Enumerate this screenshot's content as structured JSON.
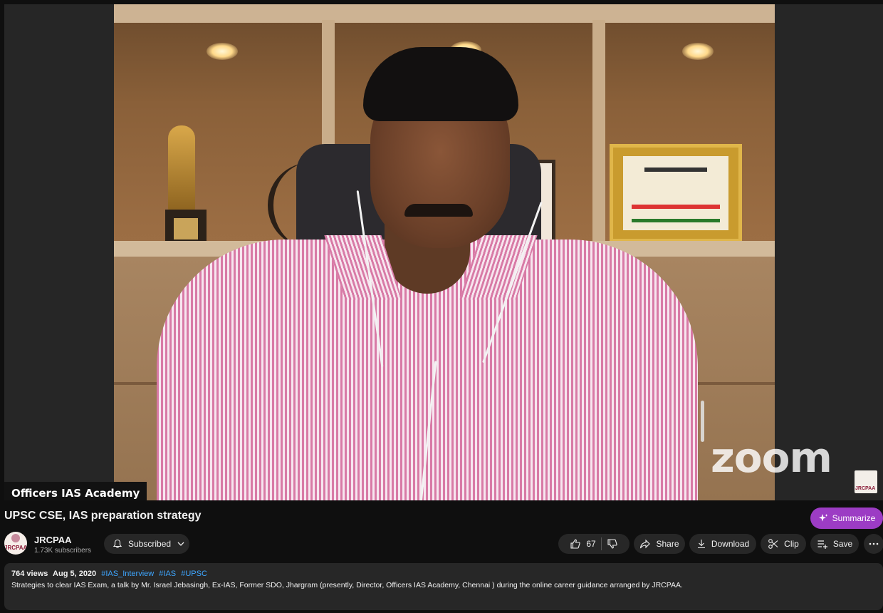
{
  "player": {
    "channel_watermark": "Officers IAS Academy",
    "zoom_watermark": "zoom",
    "corner_logo": "JRCPAA"
  },
  "video": {
    "title": "UPSC CSE, IAS preparation strategy",
    "summarize_label": "Summarize"
  },
  "channel": {
    "name": "JRCPAA",
    "subscribers": "1.73K subscribers",
    "avatar_text": "JRCPAA",
    "subscribe_state": "Subscribed"
  },
  "actions": {
    "likes": "67",
    "share": "Share",
    "download": "Download",
    "clip": "Clip",
    "save": "Save"
  },
  "description": {
    "views": "764 views",
    "date": "Aug 5, 2020",
    "hashtags": [
      "#IAS_Interview",
      "#IAS",
      "#UPSC"
    ],
    "text": "Strategies to clear IAS Exam, a talk by Mr. Israel Jebasingh, Ex-IAS, Former SDO, Jhargram (presently, Director, Officers IAS Academy, Chennai ) during the online career guidance arranged by JRCPAA."
  },
  "colors": {
    "background": "#0f0f0f",
    "pill": "#272727",
    "summarize": "#9c3cc4",
    "hashtag": "#3ea6ff"
  },
  "icons": [
    "bell-icon",
    "chevron-down-icon",
    "thumbs-up-icon",
    "thumbs-down-icon",
    "share-icon",
    "download-icon",
    "scissors-icon",
    "save-playlist-icon",
    "more-icon",
    "sparkle-icon"
  ]
}
